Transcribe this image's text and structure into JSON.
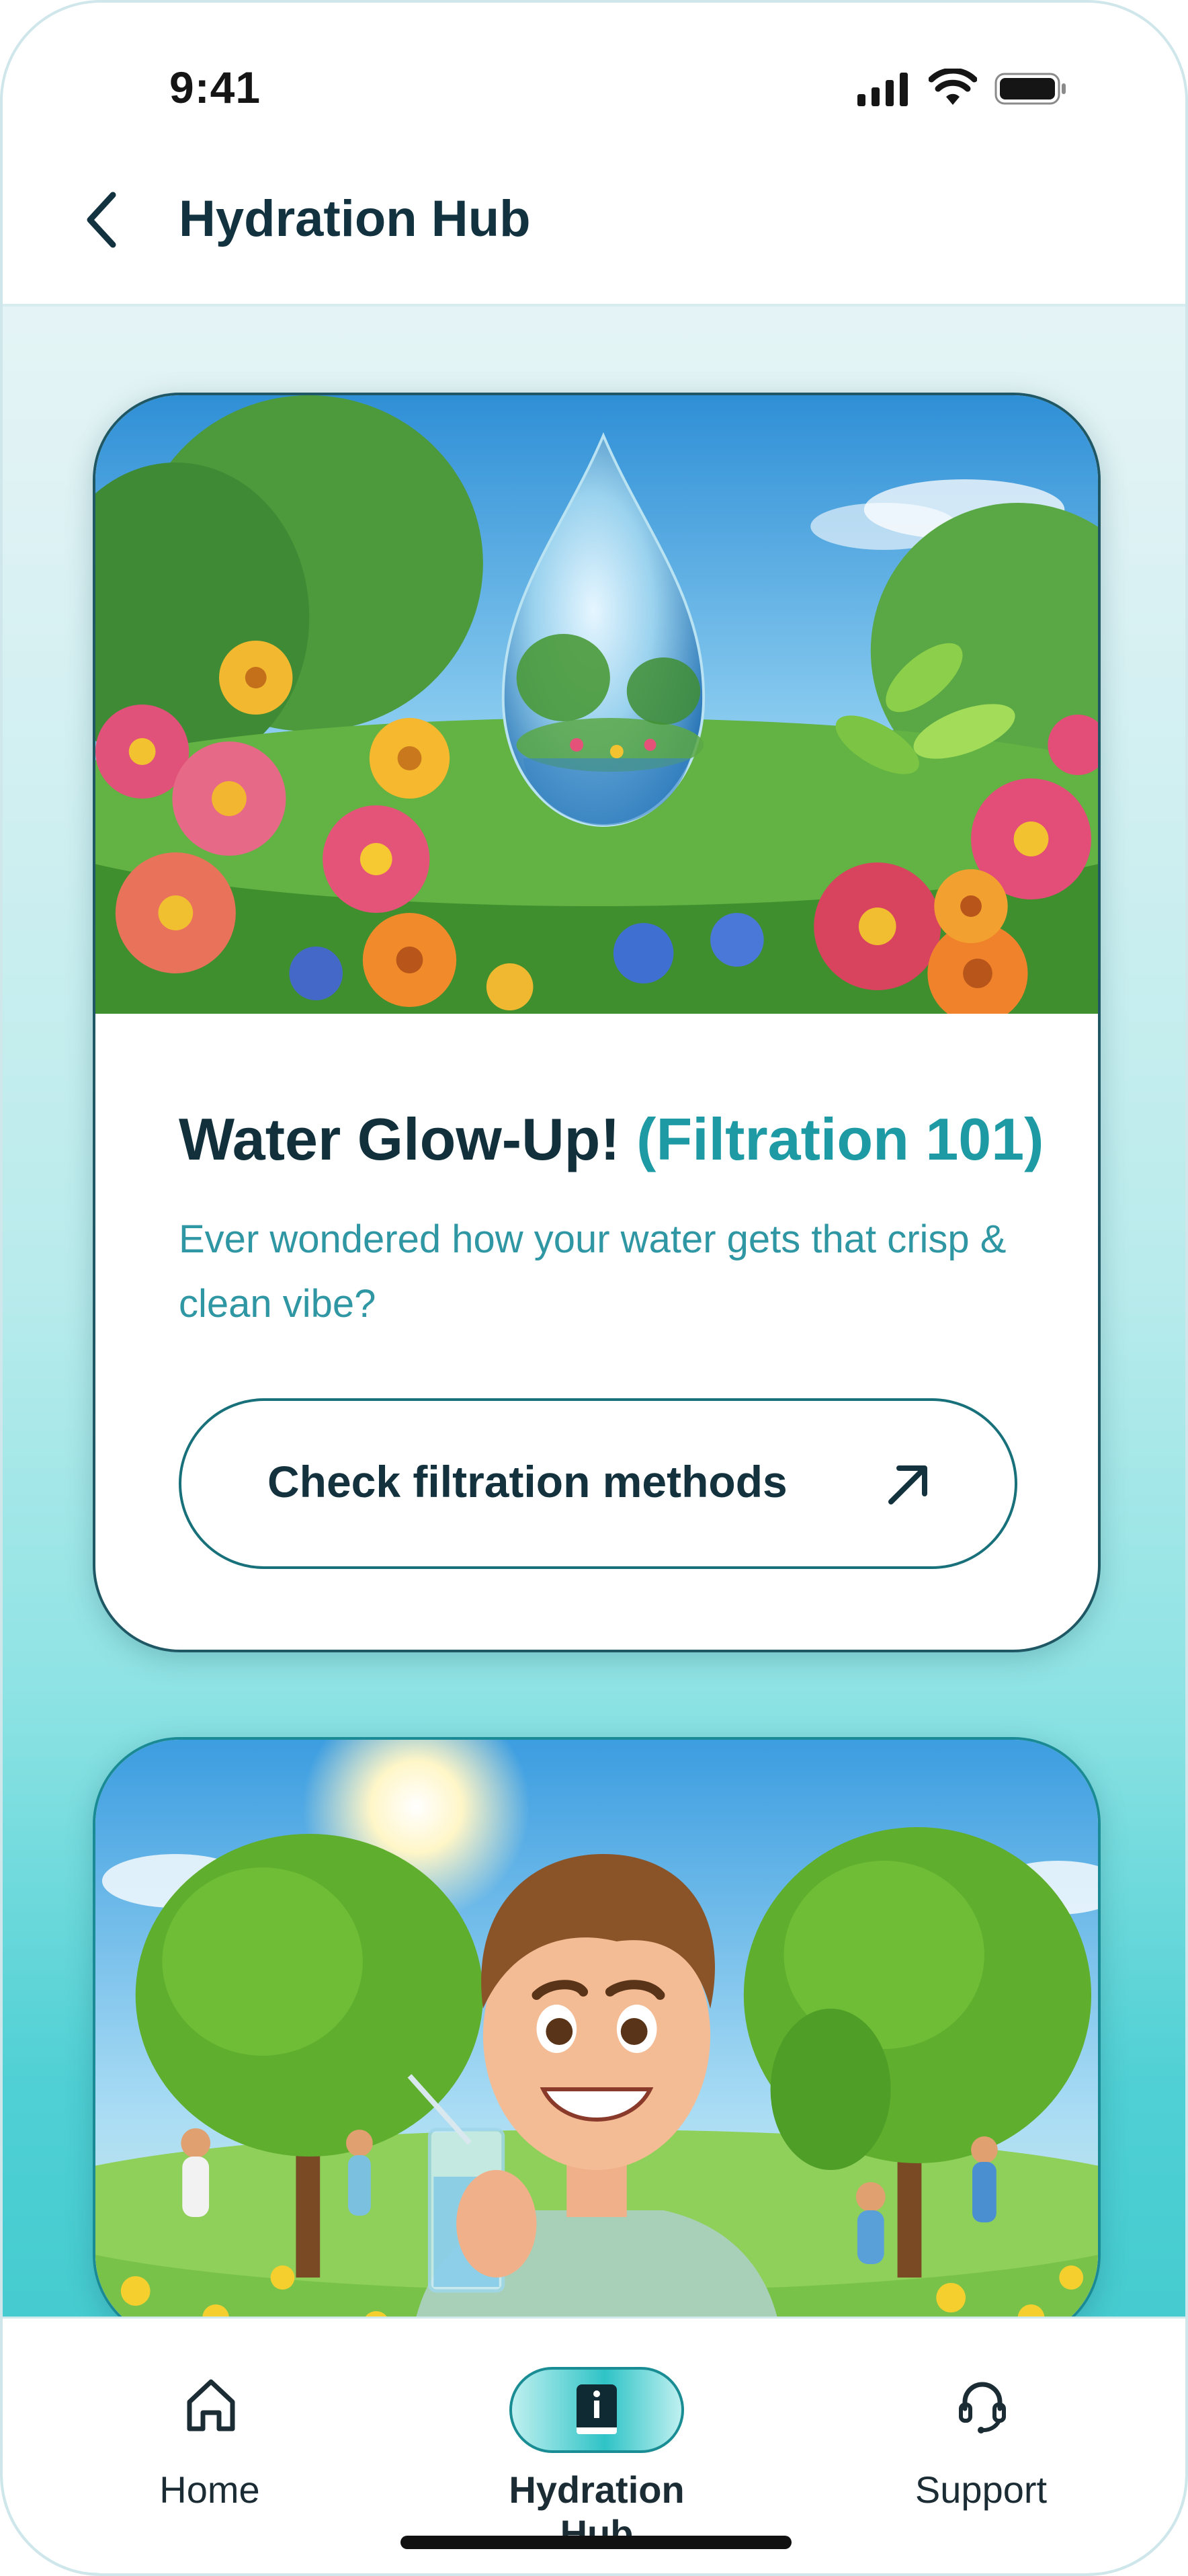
{
  "status_bar": {
    "time": "9:41",
    "icons": [
      "cellular-signal-icon",
      "wifi-icon",
      "battery-icon"
    ]
  },
  "header": {
    "back_icon": "chevron-left-icon",
    "title": "Hydration Hub"
  },
  "cards": [
    {
      "image": "water-drop-garden-illustration",
      "title_main": "Water Glow-Up!",
      "title_accent": "(Filtration 101)",
      "description": "Ever wondered how your water gets that crisp & clean vibe?",
      "cta_label": "Check filtration methods",
      "cta_icon": "arrow-up-right-icon"
    },
    {
      "image": "person-drinking-water-park-illustration"
    }
  ],
  "bottom_nav": {
    "items": [
      {
        "label": "Home",
        "icon": "home-icon",
        "active": false
      },
      {
        "label": "Hydration Hub",
        "icon": "book-info-icon",
        "active": true
      },
      {
        "label": "Support",
        "icon": "headset-icon",
        "active": false
      }
    ]
  },
  "colors": {
    "accent": "#1d9aa4",
    "title_dark": "#11303b",
    "description": "#2f96a3",
    "background_bottom": "#3bc6cb"
  }
}
